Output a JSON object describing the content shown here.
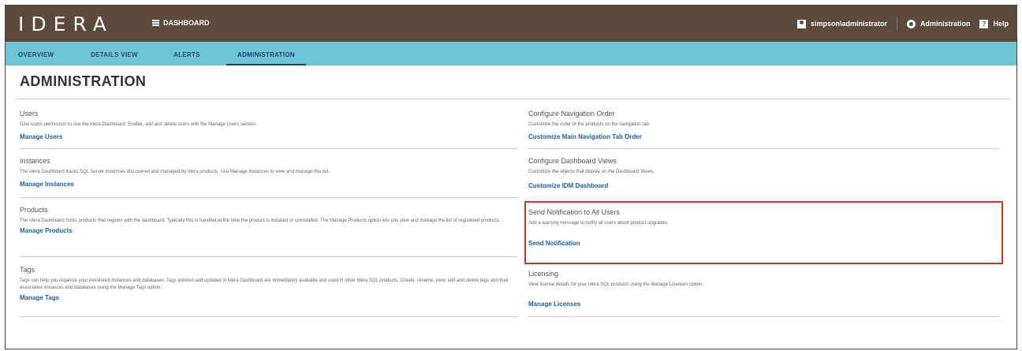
{
  "header": {
    "logo": "IDERA",
    "dashboard_label": "DASHBOARD",
    "user": "simpson\\administrator",
    "administration": "Administration",
    "help": "Help"
  },
  "tabs": [
    "OVERVIEW",
    "DETAILS VIEW",
    "ALERTS",
    "ADMINISTRATION"
  ],
  "page_title": "ADMINISTRATION",
  "left_sections": [
    {
      "title": "Users",
      "desc": "Give users permission to use the Idera Dashboard: Enable, add and delete users with the Manage Users section.",
      "link": "Manage Users"
    },
    {
      "title": "Instances",
      "desc": "The Idera Dashboard tracks SQL Server instances discovered and managed by Idera products. Use Manage Instances to view and manage this list.",
      "link": "Manage Instances"
    },
    {
      "title": "Products",
      "desc": "The Idera Dashboard hosts products that register with the dashboard. Typically this is handled at the time the product is installed or uninstalled. The Manage Products option lets you view and manage the list of registered products.",
      "link": "Manage Products"
    },
    {
      "title": "Tags",
      "desc": "Tags can help you organize your monitored instances and databases. Tags entered and updated in Idera Dashboard are immediately available and used in other Idera SQL products. Create, rename, view, edit and delete tags and their associated instances and databases using the Manage Tags option.",
      "link": "Manage Tags"
    }
  ],
  "right_sections": [
    {
      "title": "Configure Navigation Order",
      "desc": "Customize the order of the products on the navigation tab.",
      "link": "Customize Main Navigation Tab Order"
    },
    {
      "title": "Configure Dashboard Views",
      "desc": "Customize the objects that display on the Dashboard Views.",
      "link": "Customize IDM Dashboard"
    },
    {
      "title": "Send Notification to All Users",
      "desc": "Add a warning message to notify all users about product upgrades.",
      "link": "Send Notification"
    },
    {
      "title": "Licensing",
      "desc": "View license details for your Idera SQL products using the Manage Licenses option.",
      "link": "Manage Licenses"
    }
  ],
  "colors": {
    "header_bg": "#5c4a3a",
    "nav_bg": "#6fc3d6",
    "link": "#1a5f9e",
    "highlight": "#c0392b",
    "logo_accent": "#8cc63f"
  },
  "icons": [
    "menu-icon",
    "user-icon",
    "gear-icon",
    "help-icon"
  ]
}
